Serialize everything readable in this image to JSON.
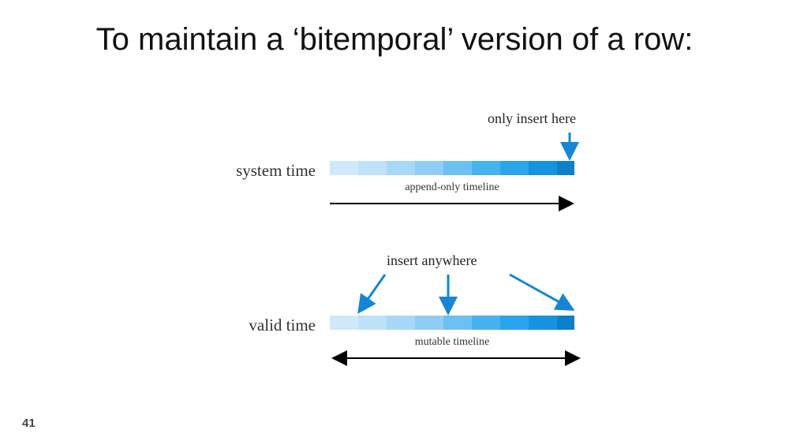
{
  "title": "To maintain a ‘bitemporal’ version of a row:",
  "page_number": "41",
  "system": {
    "label": "system time",
    "annotation": "only insert here",
    "sub": "append-only timeline"
  },
  "valid": {
    "label": "valid time",
    "annotation": "insert anywhere",
    "sub": "mutable timeline"
  },
  "colors": {
    "bar_segments": [
      "#cfe8fb",
      "#bfe1fa",
      "#a8d8f7",
      "#8fcdf4",
      "#6cc0f2",
      "#48b2ef",
      "#2aa4eb",
      "#1593e0",
      "#0d80c9"
    ],
    "arrow_blue": "#1685d6",
    "arrow_black": "#000000"
  }
}
